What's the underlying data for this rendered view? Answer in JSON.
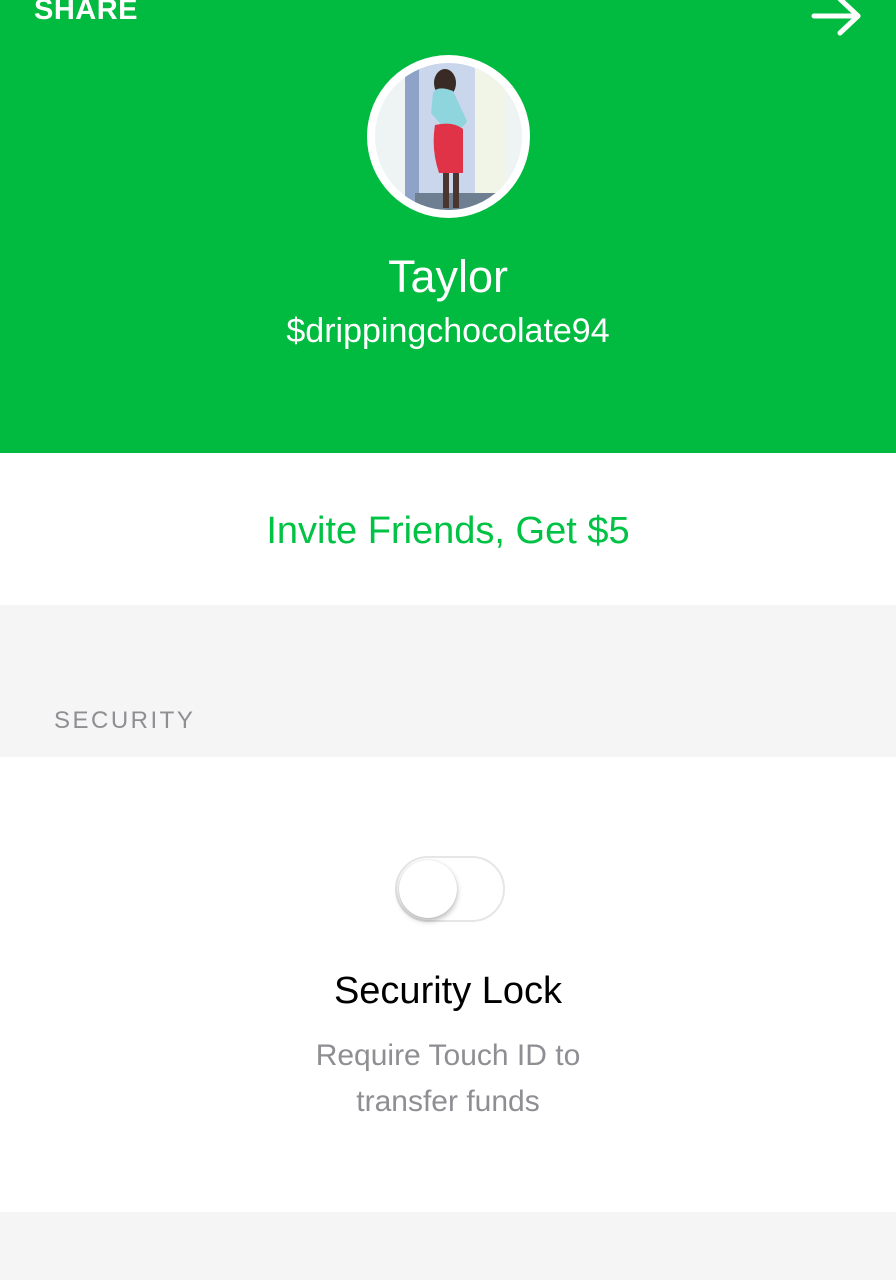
{
  "header": {
    "share_label": "SHARE",
    "forward_icon": "arrow-right-icon",
    "name": "Taylor",
    "cashtag": "$drippingchocolate94",
    "background_color": "#00bb3f"
  },
  "invite": {
    "label": "Invite Friends, Get $5",
    "color": "#00c244"
  },
  "security": {
    "section_title": "SECURITY",
    "toggle_state": "off",
    "title": "Security Lock",
    "description_line1": "Require Touch ID to",
    "description_line2": "transfer funds"
  }
}
